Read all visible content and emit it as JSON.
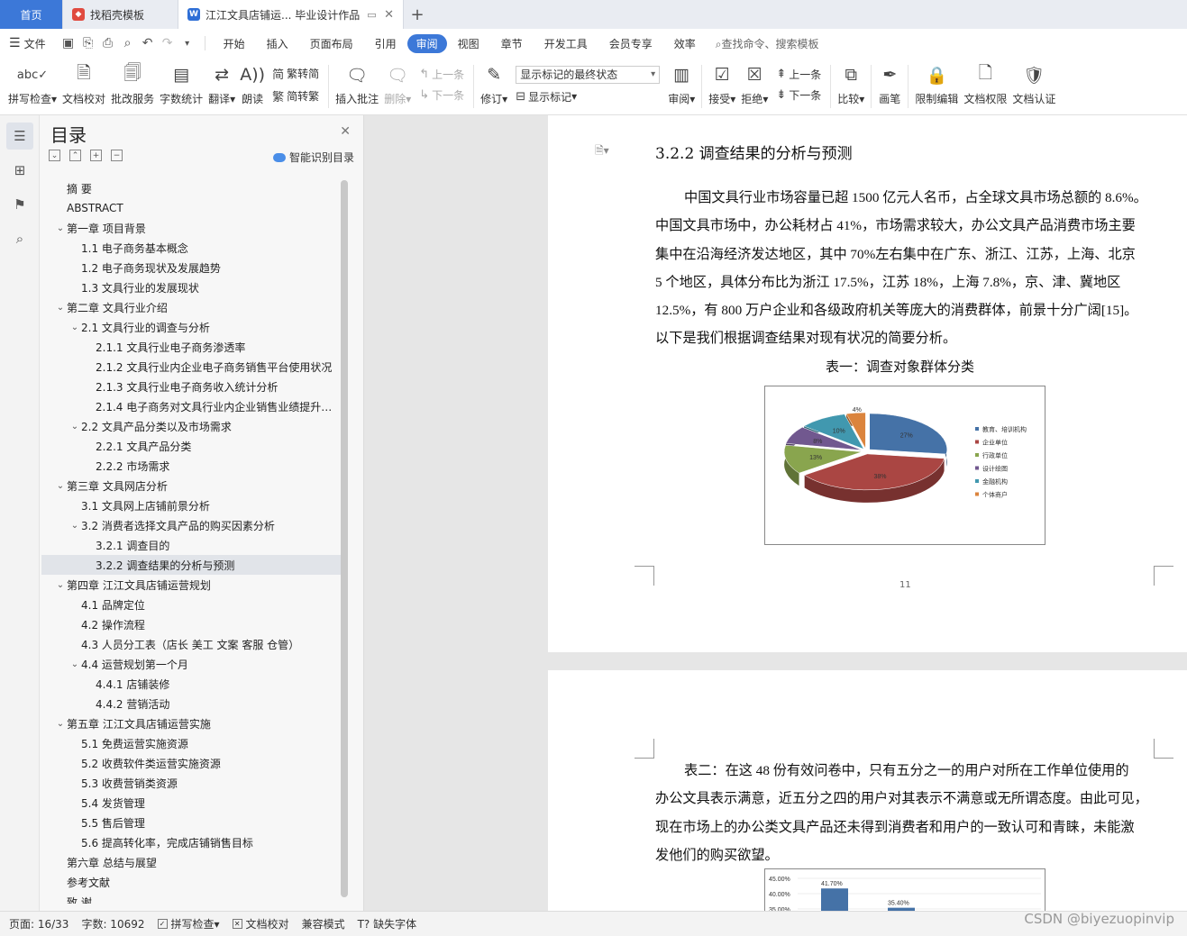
{
  "tabs": [
    {
      "label": "首页"
    },
    {
      "label": "找稻壳模板"
    },
    {
      "label": "江江文具店铺运... 毕业设计作品"
    }
  ],
  "menu": {
    "file": "文件",
    "items": [
      "开始",
      "插入",
      "页面布局",
      "引用",
      "审阅",
      "视图",
      "章节",
      "开发工具",
      "会员专享",
      "效率"
    ],
    "active": "审阅",
    "search": "查找命令、搜索模板"
  },
  "ribbon": {
    "spell": "拼写检查",
    "proof": "文档校对",
    "batch": "批改服务",
    "wordcount": "字数统计",
    "translate": "翻译",
    "read": "朗读",
    "trad": "繁转简",
    "simp": "简转繁",
    "insert_comment": "插入批注",
    "delete": "删除",
    "prev": "上一条",
    "next": "下一条",
    "revise": "修订",
    "markup_state": "显示标记的最终状态",
    "show_markup": "显示标记",
    "review": "审阅",
    "accept": "接受",
    "reject": "拒绝",
    "prev2": "上一条",
    "next2": "下一条",
    "compare": "比较",
    "pen": "画笔",
    "restrict": "限制编辑",
    "perm": "文档权限",
    "cert": "文档认证"
  },
  "toc": {
    "title": "目录",
    "smart": "智能识别目录",
    "items": [
      {
        "level": 0,
        "arrow": "",
        "text": "摘    要"
      },
      {
        "level": 0,
        "arrow": "",
        "text": "ABSTRACT"
      },
      {
        "level": 0,
        "arrow": "v",
        "text": "第一章  项目背景"
      },
      {
        "level": 1,
        "arrow": "",
        "text": "1.1 电子商务基本概念"
      },
      {
        "level": 1,
        "arrow": "",
        "text": "1.2 电子商务现状及发展趋势"
      },
      {
        "level": 1,
        "arrow": "",
        "text": "1.3 文具行业的发展现状"
      },
      {
        "level": 0,
        "arrow": "v",
        "text": "第二章  文具行业介绍"
      },
      {
        "level": 1,
        "arrow": "v",
        "text": "2.1 文具行业的调查与分析"
      },
      {
        "level": 2,
        "arrow": "",
        "text": "2.1.1 文具行业电子商务渗透率"
      },
      {
        "level": 2,
        "arrow": "",
        "text": "2.1.2 文具行业内企业电子商务销售平台使用状况"
      },
      {
        "level": 2,
        "arrow": "",
        "text": "2.1.3 文具行业电子商务收入统计分析"
      },
      {
        "level": 2,
        "arrow": "",
        "text": "2.1.4 电子商务对文具行业内企业销售业绩提升情况"
      },
      {
        "level": 1,
        "arrow": "v",
        "text": "2.2 文具产品分类以及市场需求"
      },
      {
        "level": 2,
        "arrow": "",
        "text": "2.2.1 文具产品分类"
      },
      {
        "level": 2,
        "arrow": "",
        "text": "2.2.2 市场需求"
      },
      {
        "level": 0,
        "arrow": "v",
        "text": "第三章  文具网店分析"
      },
      {
        "level": 1,
        "arrow": "",
        "text": "3.1 文具网上店铺前景分析"
      },
      {
        "level": 1,
        "arrow": "v",
        "text": "3.2 消费者选择文具产品的购买因素分析"
      },
      {
        "level": 2,
        "arrow": "",
        "text": "3.2.1 调查目的"
      },
      {
        "level": 2,
        "arrow": "",
        "text": "3.2.2 调查结果的分析与预测",
        "selected": true
      },
      {
        "level": 0,
        "arrow": "v",
        "text": "第四章  江江文具店铺运营规划"
      },
      {
        "level": 1,
        "arrow": "",
        "text": "4.1 品牌定位"
      },
      {
        "level": 1,
        "arrow": "",
        "text": "4.2 操作流程"
      },
      {
        "level": 1,
        "arrow": "",
        "text": "4.3 人员分工表（店长  美工  文案  客服  仓管）"
      },
      {
        "level": 1,
        "arrow": "v",
        "text": "4.4 运营规划第一个月"
      },
      {
        "level": 2,
        "arrow": "",
        "text": "4.4.1 店铺装修"
      },
      {
        "level": 2,
        "arrow": "",
        "text": "4.4.2 营销活动"
      },
      {
        "level": 0,
        "arrow": "v",
        "text": "第五章  江江文具店铺运营实施"
      },
      {
        "level": 1,
        "arrow": "",
        "text": "5.1 免费运营实施资源"
      },
      {
        "level": 1,
        "arrow": "",
        "text": "5.2 收费软件类运营实施资源"
      },
      {
        "level": 1,
        "arrow": "",
        "text": "5.3 收费营销类资源"
      },
      {
        "level": 1,
        "arrow": "",
        "text": "5.4 发货管理"
      },
      {
        "level": 1,
        "arrow": "",
        "text": "5.5 售后管理"
      },
      {
        "level": 1,
        "arrow": "",
        "text": "5.6 提高转化率，完成店铺销售目标"
      },
      {
        "level": 0,
        "arrow": "",
        "text": "第六章  总结与展望"
      },
      {
        "level": 0,
        "arrow": "",
        "text": "参考文献"
      },
      {
        "level": 0,
        "arrow": "",
        "text": "致    谢"
      }
    ]
  },
  "doc": {
    "heading": "3.2.2 调查结果的分析与预测",
    "para1": [
      "中国文具行业市场容量已超 1500 亿元人名币，占全球文具市场总额的 8.6%。",
      "中国文具市场中，办公耗材占 41%，市场需求较大，办公文具产品消费市场主要",
      "集中在沿海经济发达地区，其中 70%左右集中在广东、浙江、江苏，上海、北京",
      "5 个地区，具体分布比为浙江 17.5%，江苏 18%，上海 7.8%，京、津、冀地区",
      "12.5%，有 800 万户企业和各级政府机关等庞大的消费群体，前景十分广阔[15]。",
      "以下是我们根据调查结果对现有状况的简要分析。"
    ],
    "caption1": "表一：调查对象群体分类",
    "page_number": "11",
    "para2": [
      "表二：在这 48 份有效问卷中，只有五分之一的用户对所在工作单位使用的",
      "办公文具表示满意，近五分之四的用户对其表示不满意或无所谓态度。由此可见，",
      "现在市场上的办公类文具产品还未得到消费者和用户的一致认可和青睐，未能激",
      "发他们的购买欲望。"
    ]
  },
  "chart_data": [
    {
      "type": "pie",
      "categories": [
        "教育、培训机构",
        "企业单位",
        "行政单位",
        "设计绘图",
        "金融机构",
        "个体商户"
      ],
      "values": [
        27,
        38,
        13,
        8,
        10,
        4
      ],
      "labels": [
        "27%",
        "38%",
        "13%",
        "8%",
        "10%",
        "4%"
      ],
      "colors": [
        "#4572a7",
        "#aa4643",
        "#89a54e",
        "#71588f",
        "#4198af",
        "#db843d"
      ],
      "legend": "right"
    },
    {
      "type": "bar",
      "categories": [
        "",
        ""
      ],
      "values": [
        41.7,
        35.4
      ],
      "labels": [
        "41.70%",
        "35.40%"
      ],
      "ytick_labels": [
        "45.00%",
        "40.00%",
        "35.00%"
      ],
      "ylim": [
        35,
        45
      ],
      "color": "#4572a7"
    }
  ],
  "status": {
    "page": "页面: 16/33",
    "words": "字数: 10692",
    "spell": "拼写检查",
    "proof": "文档校对",
    "compat": "兼容模式",
    "missing_font": "缺失字体"
  },
  "watermark": "CSDN @biyezuopinvip"
}
